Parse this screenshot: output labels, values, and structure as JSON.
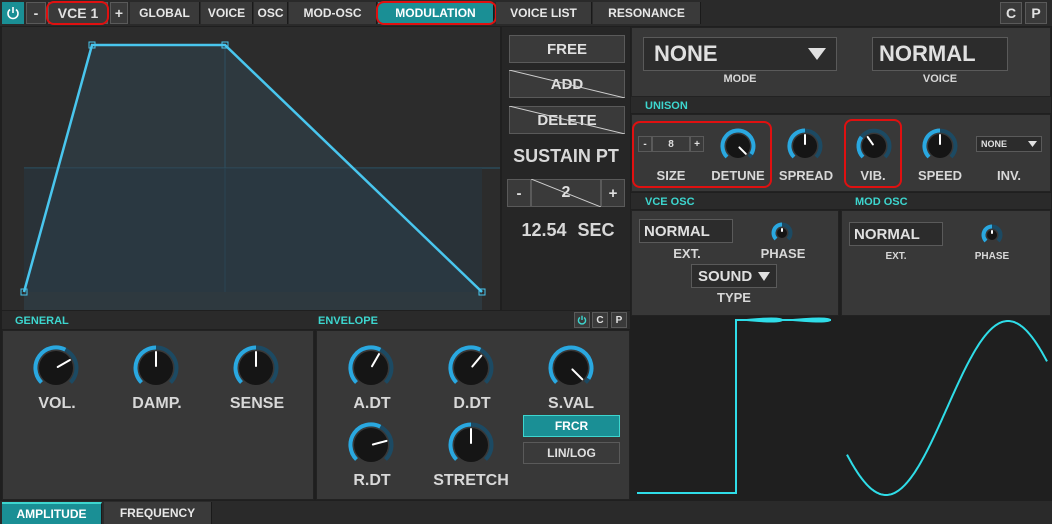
{
  "topbar": {
    "power_icon": "power-icon",
    "minus": "-",
    "voice_name": "VCE 1",
    "plus": "+",
    "tabs": [
      "GLOBAL",
      "VOICE",
      "OSC",
      "MOD-OSC",
      "MODULATION",
      "VOICE LIST",
      "RESONANCE"
    ],
    "active_tab": "MODULATION",
    "c": "C",
    "p": "P"
  },
  "envelope_controls": {
    "free": "FREE",
    "add": "ADD",
    "delete": "DELETE",
    "sustain_title": "SUSTAIN PT",
    "sustain_minus": "-",
    "sustain_value": "2",
    "sustain_plus": "+",
    "time_value": "12.54",
    "time_unit": "SEC"
  },
  "mode": {
    "value": "NONE",
    "label": "MODE"
  },
  "voice": {
    "value": "NORMAL",
    "label": "VOICE"
  },
  "unison": {
    "title": "UNISON",
    "size_minus": "-",
    "size_value": "8",
    "size_plus": "+",
    "size_label": "SIZE",
    "detune": "DETUNE",
    "spread": "SPREAD",
    "vib": "VIB.",
    "speed": "SPEED",
    "inv_value": "NONE",
    "inv_label": "INV."
  },
  "vce_osc": {
    "title": "VCE OSC",
    "ext_value": "NORMAL",
    "ext_label": "EXT.",
    "phase": "PHASE",
    "type_value": "SOUND",
    "type_label": "TYPE"
  },
  "mod_osc": {
    "title": "MOD OSC",
    "ext_value": "NORMAL",
    "ext_label": "EXT.",
    "phase": "PHASE"
  },
  "general": {
    "title": "GENERAL",
    "vol": "VOL.",
    "damp": "DAMP.",
    "sense": "SENSE"
  },
  "envelope": {
    "title": "ENVELOPE",
    "c": "C",
    "p": "P",
    "adt": "A.DT",
    "ddt": "D.DT",
    "sval": "S.VAL",
    "rdt": "R.DT",
    "stretch": "STRETCH",
    "frcr": "FRCR",
    "linlog": "LIN/LOG"
  },
  "bottom_tabs": [
    "AMPLITUDE",
    "FREQUENCY"
  ],
  "active_bottom_tab": "AMPLITUDE",
  "colors": {
    "accent": "#3dd6cf",
    "envelope_line": "#49c6ee",
    "knob_arc": "#2aa8e0",
    "highlight": "#e01010",
    "active_tab": "#1a8f95"
  }
}
